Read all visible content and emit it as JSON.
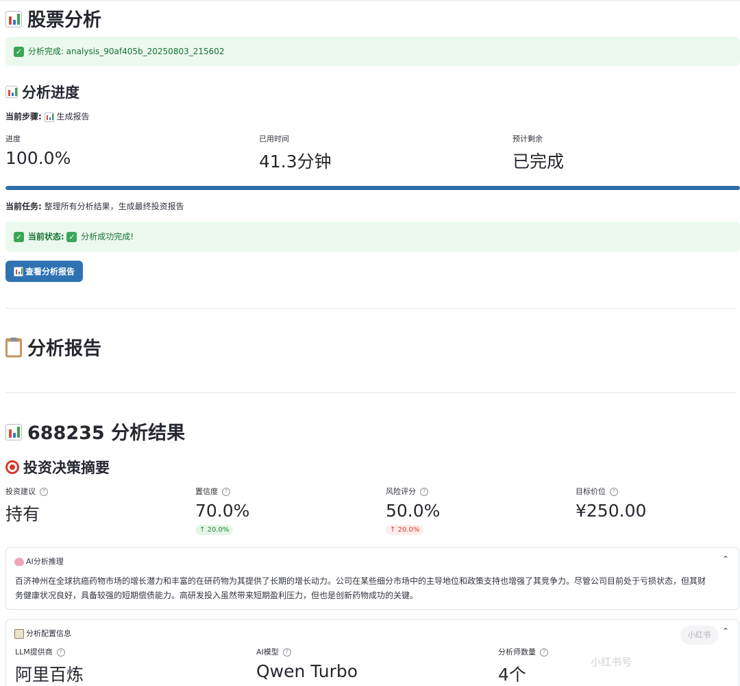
{
  "page": {
    "title": "股票分析",
    "success_alert": "分析完成: analysis_90af405b_20250803_215602"
  },
  "progress_section": {
    "title": "分析进度",
    "current_step_label": "当前步骤:",
    "current_step_value": "生成报告",
    "metrics": [
      {
        "label": "进度",
        "value": "100.0%"
      },
      {
        "label": "已用时间",
        "value": "41.3分钟"
      },
      {
        "label": "预计剩余",
        "value": "已完成"
      }
    ],
    "progress_fraction": 1.0,
    "current_task_label": "当前任务:",
    "current_task_value": "整理所有分析结果，生成最终投资报告",
    "status_label": "当前状态:",
    "status_value": "分析成功完成!",
    "view_report_button": "查看分析报告"
  },
  "report_section": {
    "title": "分析报告"
  },
  "result_section": {
    "title": "688235 分析结果",
    "summary_title": "投资决策摘要",
    "metrics": [
      {
        "label": "投资建议",
        "value": "持有",
        "delta": ""
      },
      {
        "label": "置信度",
        "value": "70.0%",
        "delta": "20.0%",
        "delta_color": "#1c8a34"
      },
      {
        "label": "风险评分",
        "value": "50.0%",
        "delta": "20.0%",
        "delta_color": "#d9382b"
      },
      {
        "label": "目标价位",
        "value": "¥250.00",
        "delta": ""
      }
    ]
  },
  "ai_reasoning": {
    "title": "AI分析推理",
    "text": "百济神州在全球抗癌药物市场的增长潜力和丰富的在研药物为其提供了长期的增长动力。公司在某些细分市场中的主导地位和政策支持也增强了其竞争力。尽管公司目前处于亏损状态，但其财务健康状况良好，具备较强的短期偿债能力。高研发投入虽然带来短期盈利压力，但也是创新药物成功的关键。"
  },
  "config_info": {
    "title": "分析配置信息",
    "metrics": [
      {
        "label": "LLM提供商",
        "value": "阿里百炼"
      },
      {
        "label": "AI模型",
        "value": "Qwen Turbo"
      },
      {
        "label": "分析师数量",
        "value": "4个"
      }
    ]
  },
  "watermark": {
    "text": "小红书号",
    "badge": "小红书"
  },
  "icons": {
    "chart": "bar-chart-icon",
    "check": "check-mark-icon",
    "clipboard": "clipboard-icon",
    "target": "direct-hit-icon",
    "brain": "brain-icon",
    "ledger": "ledger-icon",
    "help": "question-circle-icon",
    "chevron": "chevron-up-icon",
    "arrow_up": "arrow-up-icon"
  },
  "colors": {
    "primary": "#2e72b3",
    "success_bg": "#ebf8ee",
    "success_text": "#177233",
    "delta_green": "#1c8a34",
    "delta_red": "#d9382b"
  }
}
